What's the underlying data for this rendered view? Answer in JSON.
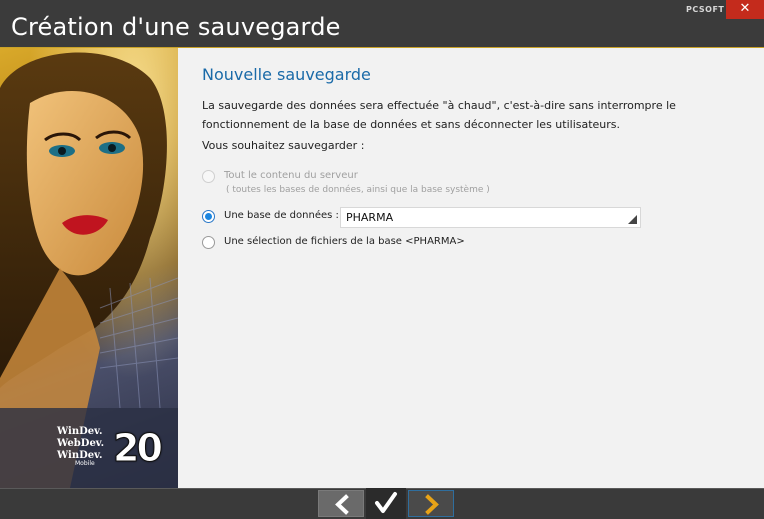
{
  "window": {
    "title": "Création d'une sauvegarde",
    "brand": "PCSOFT",
    "close_label": "✕"
  },
  "side_panel": {
    "logo_lines": [
      "WinDev.",
      "WebDev.",
      "WinDev."
    ],
    "logo_sub": "Mobile",
    "version": "20"
  },
  "content": {
    "heading": "Nouvelle sauvegarde",
    "description": "La sauvegarde des données sera effectuée \"à chaud\", c'est-à-dire sans interrompre le fonctionnement de la base de données et sans déconnecter les utilisateurs.",
    "question": "Vous souhaitez sauvegarder :",
    "options": [
      {
        "label": "Tout le contenu du serveur",
        "sublabel": "( toutes les bases de données, ainsi que la base système )",
        "state": "disabled"
      },
      {
        "label": "Une base de données :",
        "state": "checked"
      },
      {
        "label": "Une sélection de fichiers de la base <PHARMA>",
        "state": "unchecked"
      }
    ],
    "database_combo": {
      "value": "PHARMA"
    }
  },
  "bottom_bar": {
    "buttons": [
      {
        "name": "previous",
        "icon": "chevron-left-icon"
      },
      {
        "name": "validate",
        "icon": "checkmark-icon"
      },
      {
        "name": "next",
        "icon": "chevron-right-icon"
      }
    ]
  },
  "colors": {
    "heading": "#1a6aa8",
    "accent_line": "#c9a227",
    "radio_checked": "#1c86e0",
    "close_button": "#c42b1c",
    "next_chevron": "#e8a317"
  }
}
